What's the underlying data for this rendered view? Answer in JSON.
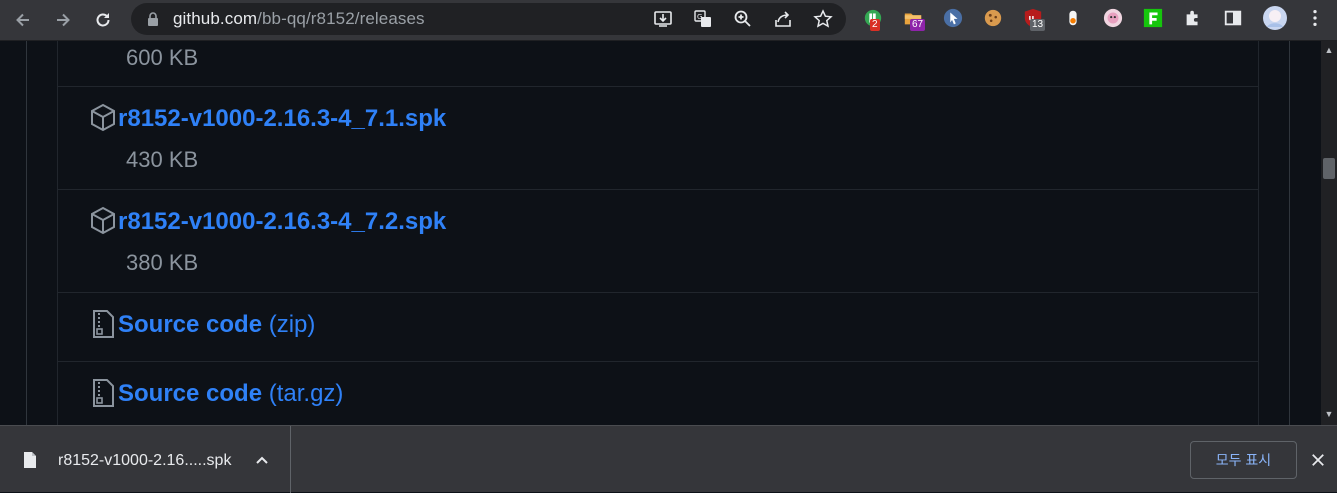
{
  "browser": {
    "url_host": "github.com",
    "url_path": "/bb-qq/r8152/releases",
    "extensions": [
      {
        "name": "extension-ublock-style-icon",
        "badge": "2",
        "badge_color": "#d93025"
      },
      {
        "name": "extension-folder-icon",
        "badge": "67",
        "badge_color": "#8e24aa"
      },
      {
        "name": "extension-cursor-icon",
        "badge": "",
        "badge_color": ""
      },
      {
        "name": "extension-cookie-icon",
        "badge": "",
        "badge_color": ""
      },
      {
        "name": "extension-ublock-icon",
        "badge": "13",
        "badge_color": "#5f6368"
      },
      {
        "name": "extension-drop-icon",
        "badge": "",
        "badge_color": ""
      },
      {
        "name": "extension-anime-icon",
        "badge": "",
        "badge_color": ""
      },
      {
        "name": "extension-f-icon",
        "badge": "",
        "badge_color": ""
      }
    ]
  },
  "assets": {
    "top_size": "600 KB",
    "items": [
      {
        "name": "r8152-v1000-2.16.3-4_7.1.spk",
        "size": "430 KB",
        "icon": "package-icon"
      },
      {
        "name": "r8152-v1000-2.16.3-4_7.2.spk",
        "size": "380 KB",
        "icon": "package-icon"
      }
    ],
    "source": [
      {
        "label": "Source code",
        "suffix": "(zip)",
        "icon": "file-zip-icon"
      },
      {
        "label": "Source code",
        "suffix": "(tar.gz)",
        "icon": "file-zip-icon"
      }
    ]
  },
  "downloads": {
    "file_name": "r8152-v1000-2.16.....spk",
    "show_all_label": "모두 표시"
  },
  "colors": {
    "link": "#2f81f7",
    "muted": "#8b949e",
    "page_bg": "#0d1117"
  }
}
